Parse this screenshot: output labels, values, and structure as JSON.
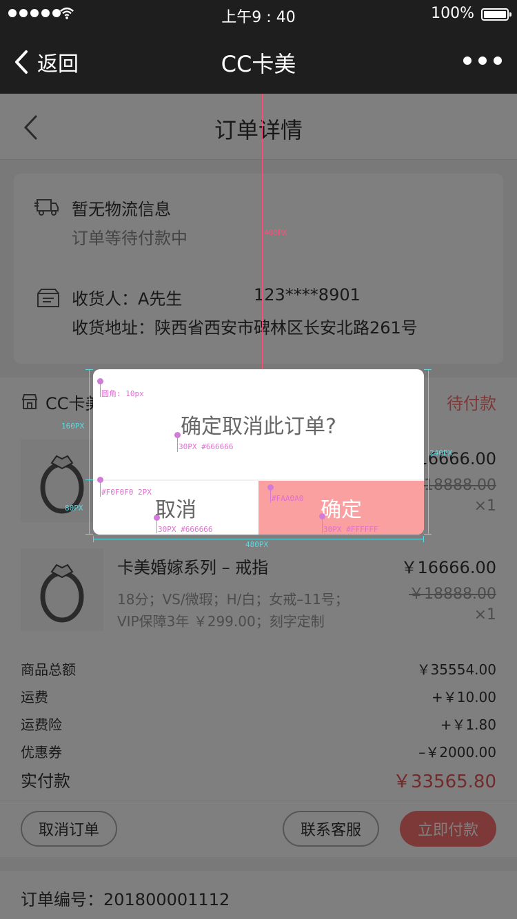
{
  "status_bar": {
    "time": "上午9 : 40",
    "battery": "100%"
  },
  "nav": {
    "back": "返回",
    "title": "CC卡美"
  },
  "page": {
    "title": "订单详情"
  },
  "logistics": {
    "title": "暂无物流信息",
    "subtitle": "订单等待付款中"
  },
  "receiver": {
    "name": "收货人：A先生",
    "phone": "123****8901",
    "address": "收货地址：陕西省西安市碑林区长安北路261号"
  },
  "shop": {
    "name": "CC卡美",
    "status": "待付款"
  },
  "items": [
    {
      "name": "",
      "price": "￥16666.00",
      "orig_price": "￥18888.00",
      "qty": "×1",
      "spec1": "",
      "spec2": ""
    },
    {
      "name": "卡美婚嫁系列 – 戒指",
      "price": "￥16666.00",
      "orig_price": "￥18888.00",
      "qty": "×1",
      "spec1": "18分；VS/微瑕；H/白；女戒–11号；",
      "spec2": "VIP保障3年 ￥299.00；刻字定制"
    }
  ],
  "summary": {
    "goods_label": "商品总额",
    "goods_value": "￥35554.00",
    "freight_label": "运费",
    "freight_value": "+￥10.00",
    "insurance_label": "运费险",
    "insurance_value": "+￥1.80",
    "coupon_label": "优惠券",
    "coupon_value": "–￥2000.00",
    "paid_label": "实付款",
    "paid_value": "￥33565.80"
  },
  "actions": {
    "cancel": "取消订单",
    "contact": "联系客服",
    "pay": "立即付款"
  },
  "order": {
    "number": "订单编号：201800001112"
  },
  "dialog": {
    "message": "确定取消此订单?",
    "cancel": "取消",
    "confirm": "确定"
  },
  "annotations": {
    "radius": "圆角: 10px",
    "msg_style": "30PX #666666",
    "divider": "#F0F0F0  2PX",
    "cancel_style": "30PX #666666",
    "confirm_bg": "#FAA0A0",
    "confirm_style": "30PX #FFFFFF",
    "top_dist": "400PX",
    "msg_h": "160PX",
    "btn_h": "80PX",
    "dialog_h": "240PX",
    "dialog_w": "480PX"
  },
  "colors": {
    "confirm_bg": "#FAA0A0",
    "text_gray": "#666666",
    "divider": "#F0F0F0",
    "accent": "#FA7070"
  }
}
